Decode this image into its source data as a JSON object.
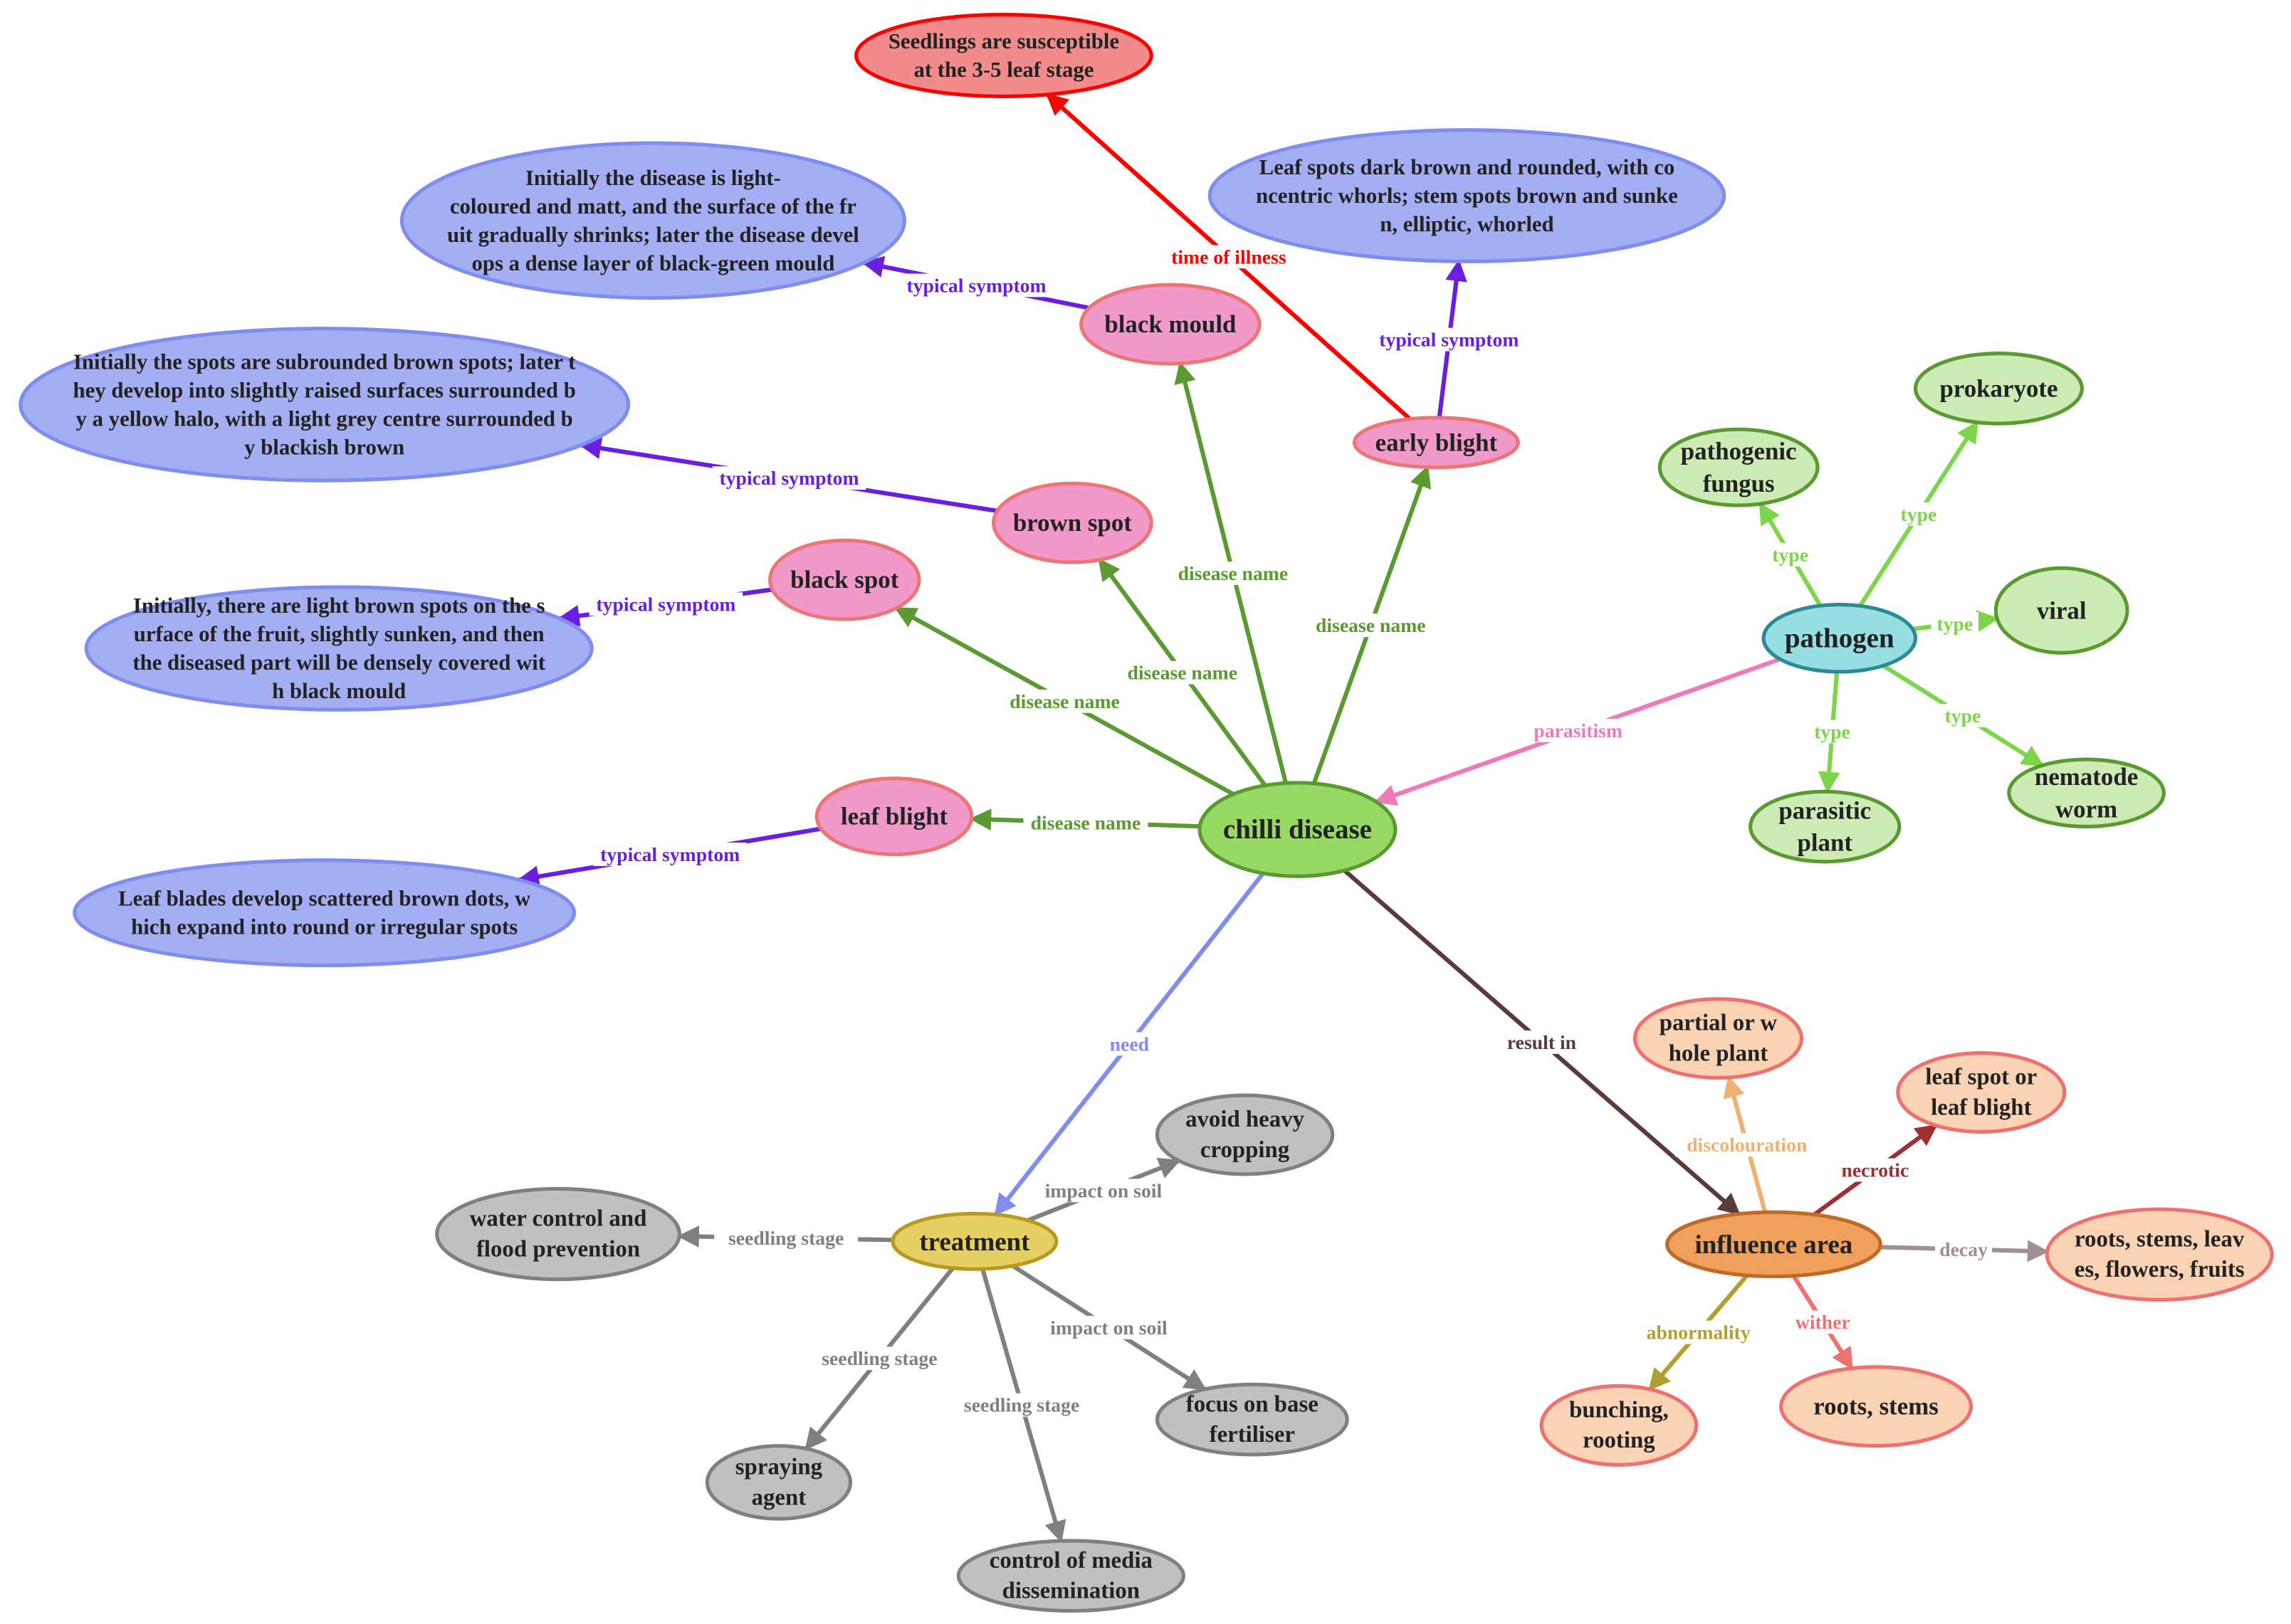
{
  "palette": {
    "symptom_fill": "#a4aef2",
    "symptom_stroke": "#7f8cf0",
    "disease_fill": "#f19ac9",
    "disease_stroke": "#ee7575",
    "stage_fill": "#f28b8b",
    "stage_stroke": "#ff0000",
    "root_fill": "#98d966",
    "root_stroke": "#5a9a30",
    "pathogen_fill": "#97dfe3",
    "pathogen_stroke": "#2a8a96",
    "type_fill": "#cdebb4",
    "type_stroke": "#5a9a30",
    "treatment_fill": "#e7d063",
    "treatment_stroke": "#b89a20",
    "measure_fill": "#c0c0c0",
    "measure_stroke": "#808080",
    "influence_fill": "#f0a05a",
    "influence_stroke": "#c06a2a",
    "effect_fill": "#f9d3b3",
    "effect_stroke": "#f07070"
  },
  "nodes": [
    {
      "id": "seedlings",
      "kind": "stage",
      "lines": [
        "Seedlings are susceptible",
        "at the 3-5 leaf stage"
      ]
    },
    {
      "id": "sym_mould",
      "kind": "symptom",
      "lines": [
        "Initially the disease is light-",
        "coloured and matt, and the surface of the fr",
        "uit gradually shrinks; later the disease devel",
        "ops a dense layer of black-green mould"
      ]
    },
    {
      "id": "sym_early",
      "kind": "symptom",
      "lines": [
        "Leaf spots dark brown and rounded, with co",
        "ncentric whorls; stem spots brown and sunke",
        "n, elliptic, whorled"
      ]
    },
    {
      "id": "black_mould",
      "kind": "disease",
      "lines": [
        "black mould"
      ]
    },
    {
      "id": "early_blight",
      "kind": "disease",
      "lines": [
        "early blight"
      ]
    },
    {
      "id": "sym_brown",
      "kind": "symptom",
      "lines": [
        "Initially the spots are subrounded brown spots; later t",
        "hey develop into slightly raised surfaces surrounded b",
        "y a yellow halo, with a light grey centre surrounded b",
        "y blackish brown"
      ]
    },
    {
      "id": "brown_spot",
      "kind": "disease",
      "lines": [
        "brown spot"
      ]
    },
    {
      "id": "black_spot",
      "kind": "disease",
      "lines": [
        "black spot"
      ]
    },
    {
      "id": "sym_black_spot",
      "kind": "symptom",
      "lines": [
        "Initially, there are light brown spots on the s",
        "urface of the fruit, slightly sunken, and then",
        "the diseased part will be densely covered wit",
        "h black mould"
      ]
    },
    {
      "id": "leaf_blight",
      "kind": "disease",
      "lines": [
        "leaf blight"
      ]
    },
    {
      "id": "sym_leaf",
      "kind": "symptom",
      "lines": [
        "Leaf blades develop scattered brown dots, w",
        "hich expand into round or irregular spots"
      ]
    },
    {
      "id": "chilli",
      "kind": "root",
      "lines": [
        "chilli disease"
      ]
    },
    {
      "id": "pathogen",
      "kind": "pathogen",
      "lines": [
        "pathogen"
      ]
    },
    {
      "id": "prokaryote",
      "kind": "type",
      "lines": [
        "prokaryote"
      ]
    },
    {
      "id": "fungus",
      "kind": "type",
      "lines": [
        "pathogenic",
        "fungus"
      ]
    },
    {
      "id": "viral",
      "kind": "type",
      "lines": [
        "viral"
      ]
    },
    {
      "id": "parasitic_plant",
      "kind": "type",
      "lines": [
        "parasitic",
        "plant"
      ]
    },
    {
      "id": "nematode",
      "kind": "type",
      "lines": [
        "nematode",
        "worm"
      ]
    },
    {
      "id": "treatment",
      "kind": "treatment",
      "lines": [
        "treatment"
      ]
    },
    {
      "id": "avoid",
      "kind": "measure",
      "lines": [
        "avoid heavy",
        "cropping"
      ]
    },
    {
      "id": "water",
      "kind": "measure",
      "lines": [
        "water control and",
        "flood prevention"
      ]
    },
    {
      "id": "spraying",
      "kind": "measure",
      "lines": [
        "spraying",
        "agent"
      ]
    },
    {
      "id": "fertiliser",
      "kind": "measure",
      "lines": [
        "focus on base",
        "fertiliser"
      ]
    },
    {
      "id": "media",
      "kind": "measure",
      "lines": [
        "control of media",
        "dissemination"
      ]
    },
    {
      "id": "influence",
      "kind": "influence",
      "lines": [
        "influence area"
      ]
    },
    {
      "id": "partial",
      "kind": "effect",
      "lines": [
        "partial or w",
        "hole plant"
      ]
    },
    {
      "id": "leafspot",
      "kind": "effect",
      "lines": [
        "leaf spot or",
        "leaf blight"
      ]
    },
    {
      "id": "organs",
      "kind": "effect",
      "lines": [
        "roots, stems, leav",
        "es, flowers, fruits"
      ]
    },
    {
      "id": "bunching",
      "kind": "effect",
      "lines": [
        "bunching,",
        "rooting"
      ]
    },
    {
      "id": "rootsstems",
      "kind": "effect",
      "lines": [
        "roots, stems"
      ]
    }
  ],
  "edges": [
    {
      "from": "early_blight",
      "to": "seedlings",
      "label": "time of illness",
      "color": "#ff0000"
    },
    {
      "from": "black_mould",
      "to": "sym_mould",
      "label": "typical symptom",
      "color": "#6a1ee0"
    },
    {
      "from": "early_blight",
      "to": "sym_early",
      "label": "typical symptom",
      "color": "#6a1ee0"
    },
    {
      "from": "brown_spot",
      "to": "sym_brown",
      "label": "typical symptom",
      "color": "#6a1ee0"
    },
    {
      "from": "black_spot",
      "to": "sym_black_spot",
      "label": "typical symptom",
      "color": "#6a1ee0"
    },
    {
      "from": "leaf_blight",
      "to": "sym_leaf",
      "label": "typical symptom",
      "color": "#6a1ee0"
    },
    {
      "from": "chilli",
      "to": "black_mould",
      "label": "disease name",
      "color": "#5a9a30"
    },
    {
      "from": "chilli",
      "to": "early_blight",
      "label": "disease name",
      "color": "#5a9a30"
    },
    {
      "from": "chilli",
      "to": "brown_spot",
      "label": "disease name",
      "color": "#5a9a30"
    },
    {
      "from": "chilli",
      "to": "black_spot",
      "label": "disease name",
      "color": "#5a9a30"
    },
    {
      "from": "chilli",
      "to": "leaf_blight",
      "label": "disease name",
      "color": "#5a9a30"
    },
    {
      "from": "pathogen",
      "to": "chilli",
      "label": "parasitism",
      "color": "#f07ab8"
    },
    {
      "from": "pathogen",
      "to": "prokaryote",
      "label": "type",
      "color": "#7dd64a"
    },
    {
      "from": "pathogen",
      "to": "fungus",
      "label": "type",
      "color": "#7dd64a"
    },
    {
      "from": "pathogen",
      "to": "viral",
      "label": "type",
      "color": "#7dd64a"
    },
    {
      "from": "pathogen",
      "to": "parasitic_plant",
      "label": "type",
      "color": "#7dd64a"
    },
    {
      "from": "pathogen",
      "to": "nematode",
      "label": "type",
      "color": "#7dd64a"
    },
    {
      "from": "chilli",
      "to": "treatment",
      "label": "need",
      "color": "#7f8cf0"
    },
    {
      "from": "chilli",
      "to": "influence",
      "label": "result in",
      "color": "#5a3a3a"
    },
    {
      "from": "treatment",
      "to": "avoid",
      "label": "impact on soil",
      "color": "#808080"
    },
    {
      "from": "treatment",
      "to": "water",
      "label": "seedling stage",
      "color": "#808080"
    },
    {
      "from": "treatment",
      "to": "spraying",
      "label": "seedling stage",
      "color": "#808080"
    },
    {
      "from": "treatment",
      "to": "media",
      "label": "seedling stage",
      "color": "#808080"
    },
    {
      "from": "treatment",
      "to": "fertiliser",
      "label": "impact on soil",
      "color": "#808080"
    },
    {
      "from": "influence",
      "to": "partial",
      "label": "discolouration",
      "color": "#f0b070"
    },
    {
      "from": "influence",
      "to": "leafspot",
      "label": "necrotic",
      "color": "#a03030"
    },
    {
      "from": "influence",
      "to": "organs",
      "label": "decay",
      "color": "#a09090"
    },
    {
      "from": "influence",
      "to": "bunching",
      "label": "abnormality",
      "color": "#b0a030"
    },
    {
      "from": "influence",
      "to": "rootsstems",
      "label": "wither",
      "color": "#f07070"
    }
  ]
}
